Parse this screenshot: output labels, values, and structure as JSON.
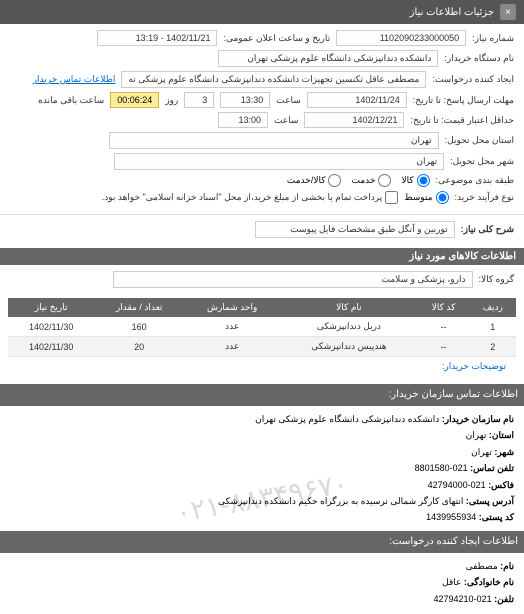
{
  "header": {
    "title": "جزئیات اطلاعات نیاز",
    "close": "×"
  },
  "need": {
    "label_number": "شماره نیاز:",
    "number": "1102090233000050",
    "label_announce": "تاریخ و ساعت اعلان عمومی:",
    "announce_datetime": "1402/11/21 - 13:19",
    "label_org": "نام دستگاه خریدار:",
    "org": "دانشکده دندانپزشکی دانشگاه علوم پزشکی تهران",
    "label_creator": "ایجاد کننده درخواست:",
    "creator": "مصطفی عاقل تکنسین تجهیزات دانشکده دندانپزشکی دانشگاه علوم پزشکی ته",
    "link_contact": "اطلاعات تماس خریدار",
    "label_deadline_send": "مهلت ارسال پاسخ: تا تاریخ:",
    "deadline_date": "1402/11/24",
    "label_time": "ساعت",
    "deadline_time": "13:30",
    "days": "3",
    "label_days": "روز",
    "remain_time": "00:06:24",
    "label_remain": "ساعت باقی مانده",
    "label_valid": "حداقل اعتبار قیمت: تا تاریخ:",
    "valid_date": "1402/12/21",
    "valid_time": "13:00",
    "label_province": "استان محل تحویل:",
    "province": "تهران",
    "label_city": "شهر محل تحویل:",
    "city": "تهران",
    "label_category": "طبقه بندی موضوعی:",
    "radio_kala": "کالا",
    "radio_khedmat": "خدمت",
    "radio_both": "کالا/خدمت",
    "label_process": "نوع فرآیند خرید:",
    "radio_mid": "متوسط",
    "checkbox_note": "پرداخت تمام یا بخشی از مبلغ خرید،از محل \"اسناد خزانه اسلامی\" خواهد بود."
  },
  "desc": {
    "label": "شرح کلی نیاز:",
    "value": "توربین و آنگل طبق مشخصات فایل پیوست"
  },
  "goods": {
    "title": "اطلاعات کالاهای مورد نیاز",
    "label_group": "گروه کالا:",
    "group": "دارو، پزشکی و سلامت",
    "headers": {
      "row": "ردیف",
      "code": "کد کالا",
      "name": "نام کالا",
      "unit": "واحد شمارش",
      "qty": "تعداد / مقدار",
      "date": "تاریخ نیاز"
    },
    "rows": [
      {
        "idx": "1",
        "code": "--",
        "name": "دریل دندانپزشکی",
        "unit": "عدد",
        "qty": "160",
        "date": "1402/11/30"
      },
      {
        "idx": "2",
        "code": "--",
        "name": "هندپیس دندانپزشکی",
        "unit": "عدد",
        "qty": "20",
        "date": "1402/11/30"
      }
    ],
    "expl_link": "توضیحات خریدار:"
  },
  "buyer_info": {
    "title": "اطلاعات تماس سازمان خریدار:",
    "org_label": "نام سازمان خریدار:",
    "org": "دانشکده دندانپزشکی دانشگاه علوم پزشکی تهران",
    "province_label": "استان:",
    "province": "تهران",
    "city_label": "شهر:",
    "city": "تهران",
    "phone_label": "تلفن تماس:",
    "phone": "021-8801580",
    "fax_label": "فاکس:",
    "fax": "021-42794000",
    "addr_label": "آدرس پستی:",
    "addr": "انتهای کارگر شمالی نرسیده به بزرگراه حکیم دانشکده دندانپزشکی",
    "postal_label": "کد پستی:",
    "postal": "1439955934"
  },
  "creator_info": {
    "title": "اطلاعات ایجاد کننده درخواست:",
    "name_label": "نام:",
    "name": "مصطفی",
    "family_label": "نام خانوادگی:",
    "family": "عاقل",
    "phone_label": "تلفن:",
    "phone": "021-42794210"
  },
  "watermark": "۰۲۱-۸۸۳۴۹۶۷۰"
}
